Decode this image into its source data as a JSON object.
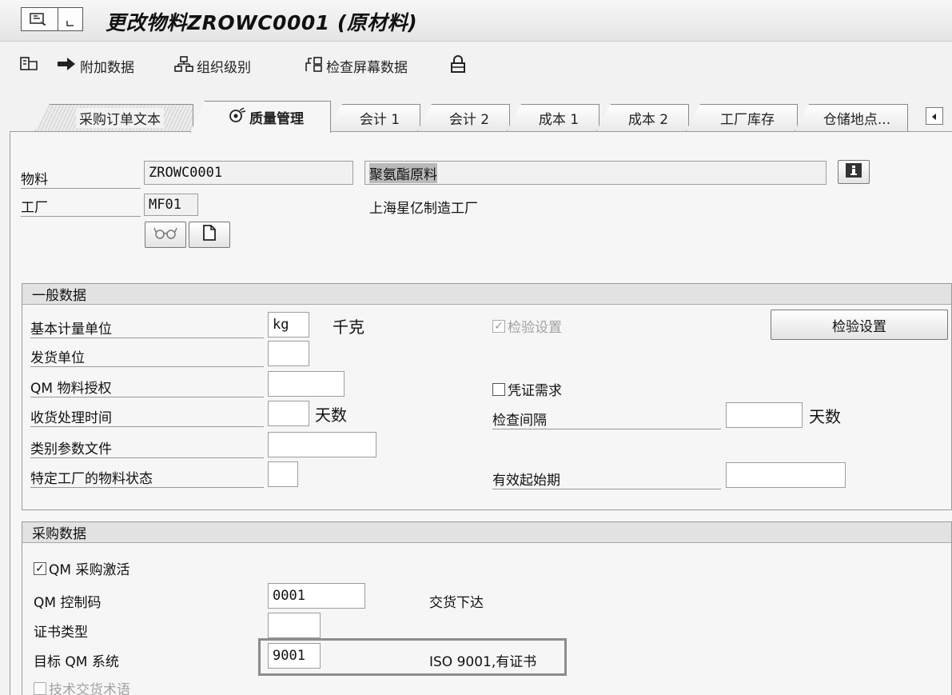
{
  "window": {
    "title": "更改物料ZROWC0001 (原材料)"
  },
  "toolbar": {
    "additional_data": "附加数据",
    "org_levels": "组织级别",
    "check_screen_data": "检查屏幕数据"
  },
  "tabs": [
    {
      "label": "采购订单文本"
    },
    {
      "label": "质量管理"
    },
    {
      "label": "会计 1"
    },
    {
      "label": "会计 2"
    },
    {
      "label": "成本 1"
    },
    {
      "label": "成本 2"
    },
    {
      "label": "工厂库存"
    },
    {
      "label": "仓储地点..."
    }
  ],
  "header": {
    "material_label": "物料",
    "material_value": "ZROWC0001",
    "material_desc": "聚氨酯原料",
    "plant_label": "工厂",
    "plant_value": "MF01",
    "plant_desc": "上海星亿制造工厂"
  },
  "general": {
    "title": "一般数据",
    "base_uom_label": "基本计量单位",
    "base_uom_value": "kg",
    "base_uom_desc": "千克",
    "issue_unit_label": "发货单位",
    "qm_auth_label": "QM 物料授权",
    "gr_time_label": "收货处理时间",
    "gr_time_unit": "天数",
    "class_profile_label": "类别参数文件",
    "plant_status_label": "特定工厂的物料状态",
    "insp_setup_check": "检验设置",
    "insp_setup_checked": true,
    "doc_required_check": "凭证需求",
    "doc_required_checked": false,
    "insp_interval_label": "检查间隔",
    "insp_interval_unit": "天数",
    "valid_from_label": "有效起始期",
    "insp_setup_button": "检验设置"
  },
  "procurement": {
    "title": "采购数据",
    "qm_active_check": "QM 采购激活",
    "qm_active_checked": true,
    "qm_control_label": "QM 控制码",
    "qm_control_value": "0001",
    "qm_control_desc": "交货下达",
    "cert_type_label": "证书类型",
    "target_qm_label": "目标 QM 系统",
    "target_qm_value": "9001",
    "target_qm_desc": "ISO 9001,有证书",
    "tech_terms_check": "技术交货术语",
    "tech_terms_checked": false
  },
  "colors": {
    "background": "#f2f2f2",
    "group_header": "#e2e2e2",
    "field_bg": "#ffffff",
    "highlight_frame": "#8c8c8c"
  }
}
